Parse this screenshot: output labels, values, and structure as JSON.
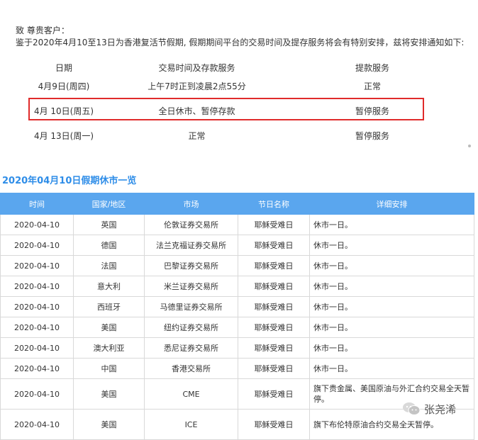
{
  "notice": {
    "greeting": "致 尊贵客户：",
    "body": "鉴于2020年4月10至13日为香港复活节假期, 假期期间平台的交易时间及提存服务将会有特别安排，兹将安排通知如下:"
  },
  "schedule": {
    "headers": [
      "日期",
      "交易时间及存款服务",
      "提款服务"
    ],
    "rows": [
      {
        "date": "4月9日(周四)",
        "trading": "上午7时正到凌晨2点55分",
        "withdraw": "正常"
      },
      {
        "date": "4月 10日(周五)",
        "trading": "全日休市、暂停存款",
        "withdraw": "暂停服务"
      },
      {
        "date": "4月 13日(周一)",
        "trading": "正常",
        "withdraw": "暂停服务"
      }
    ]
  },
  "holiday_table": {
    "title": "2020年04月10日假期休市一览",
    "headers": [
      "时间",
      "国家/地区",
      "市场",
      "节日名称",
      "详细安排"
    ],
    "rows": [
      [
        "2020-04-10",
        "英国",
        "伦敦证券交易所",
        "耶稣受难日",
        "休市一日。"
      ],
      [
        "2020-04-10",
        "德国",
        "法兰克福证券交易所",
        "耶稣受难日",
        "休市一日。"
      ],
      [
        "2020-04-10",
        "法国",
        "巴黎证券交易所",
        "耶稣受难日",
        "休市一日。"
      ],
      [
        "2020-04-10",
        "意大利",
        "米兰证券交易所",
        "耶稣受难日",
        "休市一日。"
      ],
      [
        "2020-04-10",
        "西班牙",
        "马德里证券交易所",
        "耶稣受难日",
        "休市一日。"
      ],
      [
        "2020-04-10",
        "美国",
        "纽约证券交易所",
        "耶稣受难日",
        "休市一日。"
      ],
      [
        "2020-04-10",
        "澳大利亚",
        "悉尼证券交易所",
        "耶稣受难日",
        "休市一日。"
      ],
      [
        "2020-04-10",
        "中国",
        "香港交易所",
        "耶稣受难日",
        "休市一日。"
      ],
      [
        "2020-04-10",
        "美国",
        "CME",
        "耶稣受难日",
        "旗下贵金属、美国原油与外汇合约交易全天暂停。"
      ],
      [
        "2020-04-10",
        "美国",
        "ICE",
        "耶稣受难日",
        "旗下布伦特原油合约交易全天暂停。"
      ]
    ]
  },
  "watermark": {
    "text": "张尧浠",
    "icon": "wechat-icon"
  },
  "colors": {
    "accent": "#2e8de8",
    "header_bg": "#5aa6ee",
    "highlight_border": "#e02b2b"
  }
}
